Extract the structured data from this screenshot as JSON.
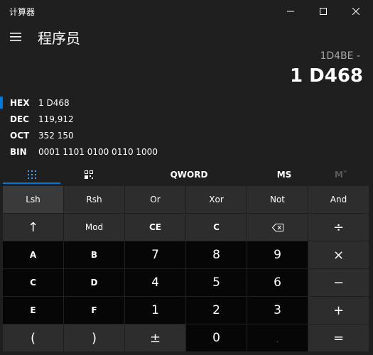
{
  "window": {
    "title": "计算器",
    "icons": [
      "minimize-icon",
      "maximize-icon",
      "close-icon"
    ]
  },
  "header": {
    "mode": "程序员",
    "menu_icon": "hamburger-icon"
  },
  "display": {
    "expression": "1D4BE -",
    "result": "1 D468"
  },
  "radix": [
    {
      "label": "HEX",
      "value": "1 D468",
      "selected": true
    },
    {
      "label": "DEC",
      "value": "119,912",
      "selected": false
    },
    {
      "label": "OCT",
      "value": "352 150",
      "selected": false
    },
    {
      "label": "BIN",
      "value": "0001 1101 0100 0110 1000",
      "selected": false
    }
  ],
  "toolbar": {
    "keypad_icon": "full-keypad-icon",
    "bitflip_icon": "bit-toggle-keypad-icon",
    "word_size": "QWORD",
    "memory_store": "MS",
    "memory_list": "M˅"
  },
  "keys": {
    "row1": [
      "Lsh",
      "Rsh",
      "Or",
      "Xor",
      "Not",
      "And"
    ],
    "row2": [
      "↑",
      "Mod",
      "CE",
      "C",
      "⌫",
      "÷"
    ],
    "row3": [
      "A",
      "B",
      "7",
      "8",
      "9",
      "×"
    ],
    "row4": [
      "C",
      "D",
      "4",
      "5",
      "6",
      "−"
    ],
    "row5": [
      "E",
      "F",
      "1",
      "2",
      "3",
      "+"
    ],
    "row6": [
      "(",
      ")",
      "±",
      "0",
      ".",
      "="
    ]
  },
  "colors": {
    "accent": "#0078d7",
    "background": "#1f1f1f",
    "function_key": "#2d2d2d",
    "number_key": "#060606"
  }
}
